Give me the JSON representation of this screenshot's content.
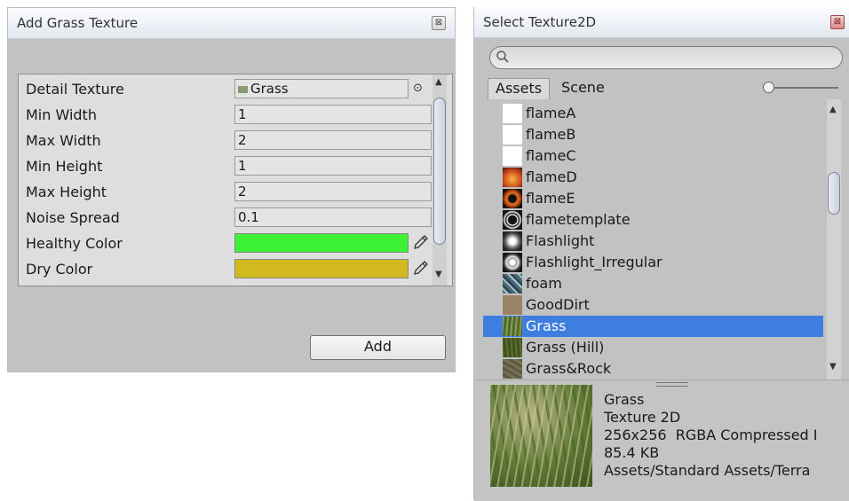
{
  "left_window": {
    "title": "Add Grass Texture",
    "close_glyph": "⊠",
    "rows": [
      {
        "label": "Detail Texture",
        "value": "Grass",
        "kind": "object"
      },
      {
        "label": "Min Width",
        "value": "1",
        "kind": "text"
      },
      {
        "label": "Max Width",
        "value": "2",
        "kind": "text"
      },
      {
        "label": "Min Height",
        "value": "1",
        "kind": "text"
      },
      {
        "label": "Max Height",
        "value": "2",
        "kind": "text"
      },
      {
        "label": "Noise Spread",
        "value": "0.1",
        "kind": "text"
      },
      {
        "label": "Healthy Color",
        "color": "#3cf235",
        "kind": "color"
      },
      {
        "label": "Dry Color",
        "color": "#d2ba1e",
        "kind": "color"
      }
    ],
    "add_button": "Add"
  },
  "right_window": {
    "title": "Select Texture2D",
    "close_glyph": "⊠",
    "search": {
      "value": "",
      "placeholder": ""
    },
    "tabs": [
      "Assets",
      "Scene"
    ],
    "items": [
      {
        "name": "flameA",
        "icon": "blank-texture-icon"
      },
      {
        "name": "flameB",
        "icon": "blank-texture-icon"
      },
      {
        "name": "flameC",
        "icon": "blank-texture-icon"
      },
      {
        "name": "flameD",
        "icon": "flame-texture-icon"
      },
      {
        "name": "flameE",
        "icon": "flame-ring-icon"
      },
      {
        "name": "flametemplate",
        "icon": "flame-template-icon"
      },
      {
        "name": "Flashlight",
        "icon": "flashlight-icon"
      },
      {
        "name": "Flashlight_Irregular",
        "icon": "flashlight-irregular-icon"
      },
      {
        "name": "foam",
        "icon": "foam-icon"
      },
      {
        "name": "GoodDirt",
        "icon": "dirt-icon"
      },
      {
        "name": "Grass",
        "icon": "grass-icon",
        "selected": true
      },
      {
        "name": "Grass (Hill)",
        "icon": "grass-hill-icon"
      },
      {
        "name": "Grass&Rock",
        "icon": "grass-rock-icon"
      }
    ],
    "preview": {
      "name": "Grass",
      "type": "Texture 2D",
      "format": "256x256  RGBA Compressed I",
      "size": "85.4 KB",
      "path": "Assets/Standard Assets/Terra"
    }
  }
}
